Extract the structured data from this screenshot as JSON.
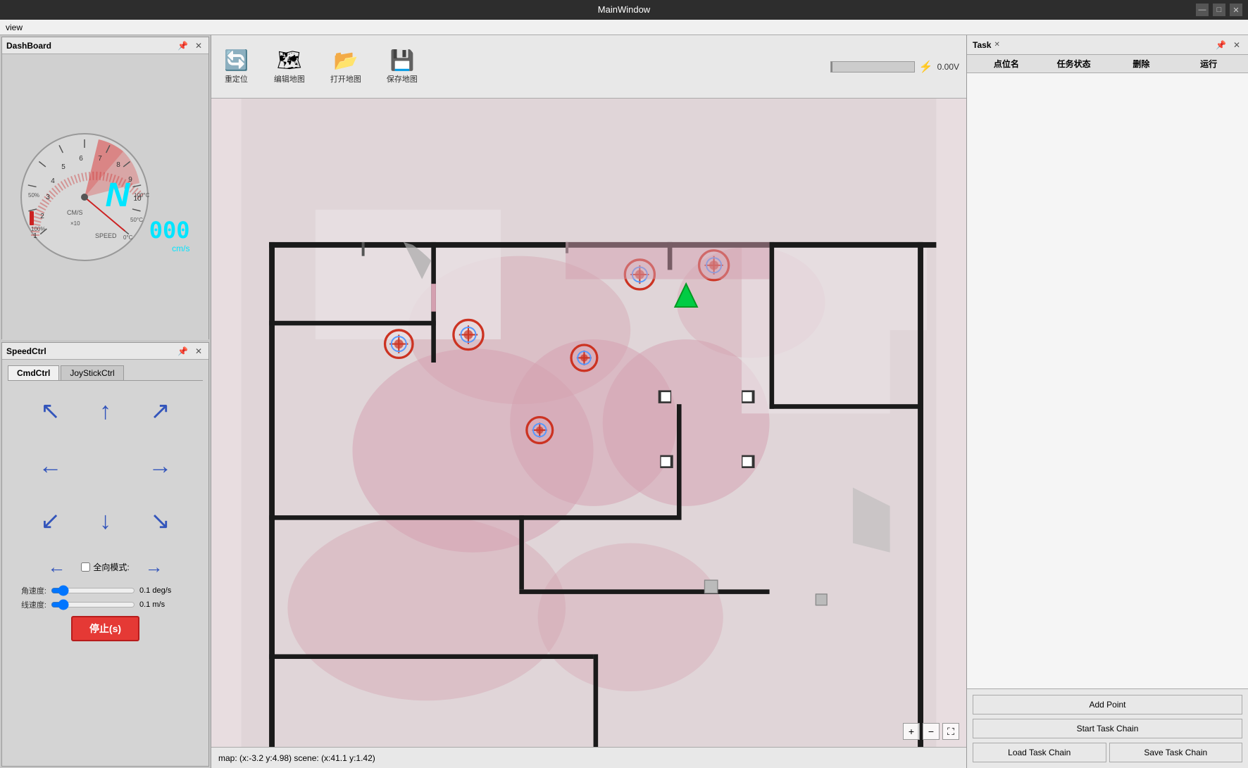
{
  "window": {
    "title": "MainWindow",
    "title_buttons": [
      "—",
      "□",
      "✕"
    ]
  },
  "menu": {
    "items": [
      "view"
    ]
  },
  "dashboard": {
    "panel_title": "DashBoard",
    "speed_value": "000",
    "speed_unit": "cm/s",
    "compass": "N",
    "speed_label": "SPEED",
    "cm_s": "CM/S",
    "scale": "×10"
  },
  "speedctrl": {
    "panel_title": "SpeedCtrl",
    "tab1": "CmdCtrl",
    "tab2": "JoyStickCtrl",
    "omni_label": "全向模式:",
    "angle_label": "角速度:",
    "angle_value": "0.1 deg/s",
    "linear_label": "线速度:",
    "linear_value": "0.1 m/s",
    "stop_label": "停止(s)",
    "directions": {
      "ul": "↖",
      "up": "↑",
      "ur": "↗",
      "left": "←",
      "center": "",
      "right": "→",
      "dl": "↙",
      "down": "↓",
      "dr": "↘"
    }
  },
  "toolbar": {
    "items": [
      {
        "label": "重定位",
        "icon": "🔄"
      },
      {
        "label": "编辑地图",
        "icon": "🗺"
      },
      {
        "label": "打开地图",
        "icon": "📂"
      },
      {
        "label": "保存地图",
        "icon": "💾"
      }
    ],
    "battery_voltage": "0.00V"
  },
  "map": {
    "status": "map: (x:-3.2 y:4.98)  scene: (x:41.1 y:1.42)",
    "zoom_in": "+",
    "zoom_out": "−",
    "zoom_fit": "⛶"
  },
  "task_panel": {
    "title": "Task",
    "col_name": "点位名",
    "col_status": "任务状态",
    "col_delete": "删除",
    "col_run": "运行",
    "add_point": "Add Point",
    "start_chain": "Start Task Chain",
    "load_chain": "Load Task Chain",
    "save_chain": "Save Task Chain"
  }
}
